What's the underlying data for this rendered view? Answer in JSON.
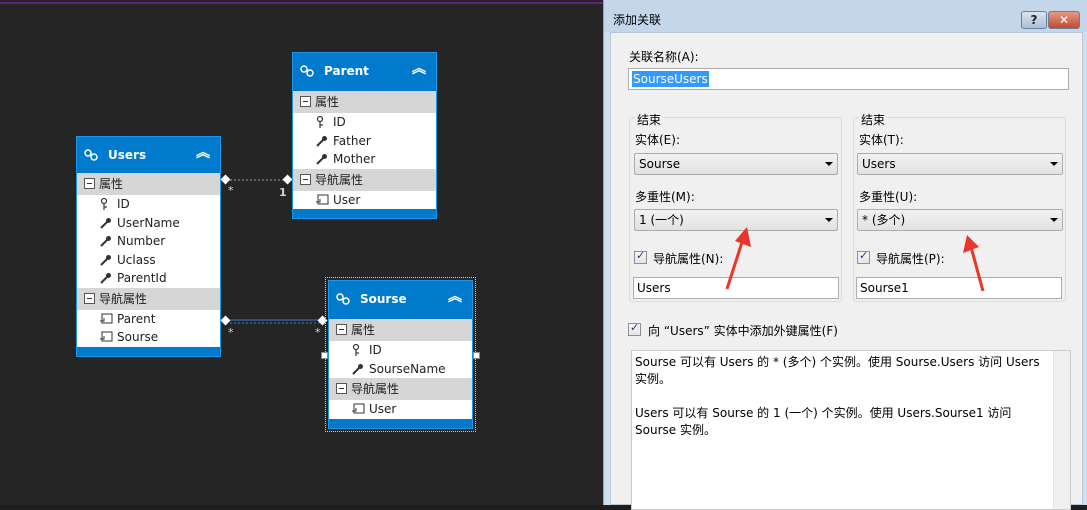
{
  "diagram": {
    "entities": {
      "users": {
        "name": "Users",
        "section_properties": "属性",
        "properties": [
          "ID",
          "UserName",
          "Number",
          "Uclass",
          "ParentId"
        ],
        "section_navigation": "导航属性",
        "navigation": [
          "Parent",
          "Sourse"
        ]
      },
      "parent": {
        "name": "Parent",
        "section_properties": "属性",
        "properties": [
          "ID",
          "Father",
          "Mother"
        ],
        "section_navigation": "导航属性",
        "navigation": [
          "User"
        ]
      },
      "sourse": {
        "name": "Sourse",
        "section_properties": "属性",
        "properties": [
          "ID",
          "SourseName"
        ],
        "section_navigation": "导航属性",
        "navigation": [
          "User"
        ]
      }
    },
    "associations": [
      {
        "from": "Users",
        "to": "Parent",
        "from_mult": "*",
        "to_mult": "1"
      },
      {
        "from": "Users",
        "to": "Sourse",
        "from_mult": "*",
        "to_mult": "*"
      }
    ],
    "colors": {
      "entity_header": "#007acc",
      "canvas": "#252526",
      "arrow": "#e8372a"
    }
  },
  "dialog": {
    "title": "添加关联",
    "help_label": "?",
    "close_label": "✕",
    "assoc_name_label": "关联名称(A):",
    "assoc_name_value": "SourseUsers",
    "end_left": {
      "group_label": "结束",
      "entity_label": "实体(E):",
      "entity_value": "Sourse",
      "mult_label": "多重性(M):",
      "mult_value": "1 (一个)",
      "nav_check_label": "导航属性(N):",
      "nav_value": "Users"
    },
    "end_right": {
      "group_label": "结束",
      "entity_label": "实体(T):",
      "entity_value": "Users",
      "mult_label": "多重性(U):",
      "mult_value": "* (多个)",
      "nav_check_label": "导航属性(P):",
      "nav_value": "Sourse1"
    },
    "fk_check_label": "向 “Users” 实体中添加外键属性(F)",
    "description": [
      "Sourse 可以有 Users 的 * (多个) 个实例。使用 Sourse.Users 访问 Users 实例。",
      "Users 可以有 Sourse 的 1 (一个) 个实例。使用 Users.Sourse1 访问 Sourse 实例。"
    ]
  }
}
